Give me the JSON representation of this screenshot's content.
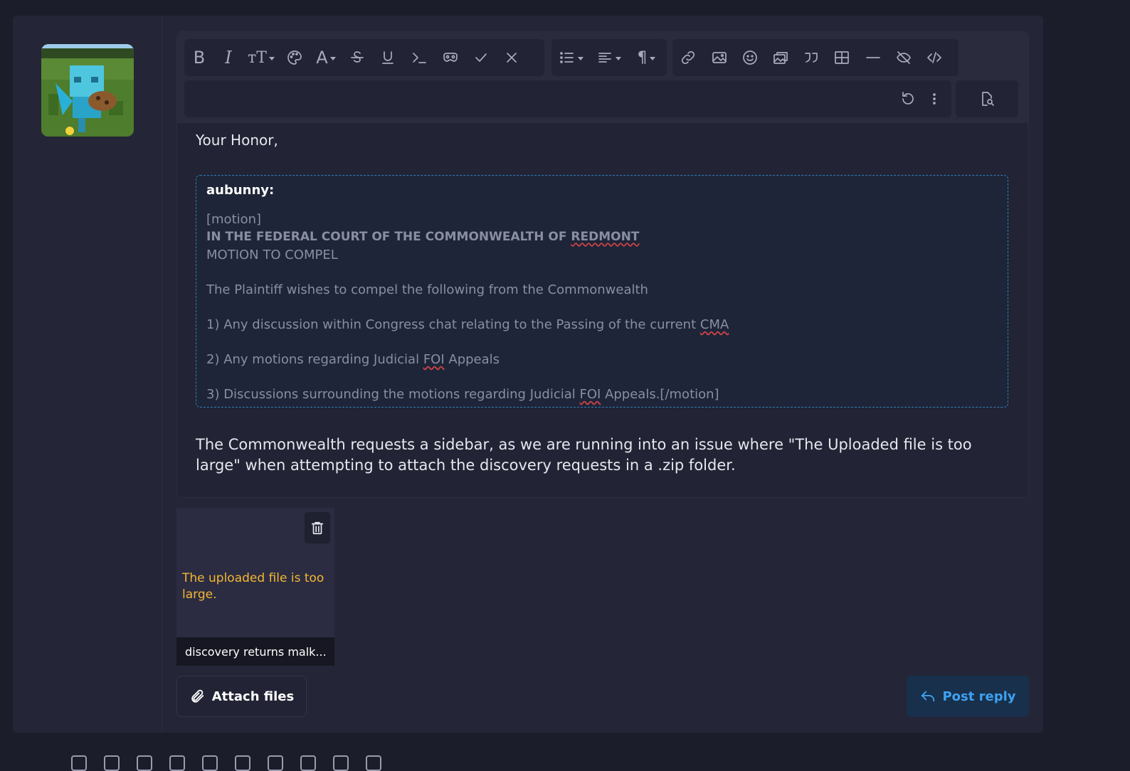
{
  "editor": {
    "greeting": "Your Honor,",
    "quote": {
      "author": "aubunny:",
      "lines": {
        "l1": "[motion]",
        "l2a": "IN THE FEDERAL COURT OF THE COMMONWEALTH OF ",
        "l2b": "REDMONT",
        "l3": "MOTION TO COMPEL",
        "l4": "The Plaintiff wishes to compel the following from the Commonwealth",
        "l5a": "1) Any discussion within Congress chat relating to the Passing of the current ",
        "l5b": "CMA",
        "l6a": "2) Any motions regarding Judicial ",
        "l6b": "FOI",
        "l6c": " Appeals",
        "l7a": "3) Discussions surrounding the motions regarding Judicial ",
        "l7b": "FOI",
        "l7c": " Appeals.[/motion]"
      }
    },
    "body": "The Commonwealth requests a sidebar, as we are running into an issue where \"The Uploaded file is too large\" when attempting to attach the discovery requests in a .zip folder."
  },
  "attachment": {
    "error": "The uploaded file is too large.",
    "filename": "discovery returns malk..."
  },
  "actions": {
    "attach_label": "Attach files",
    "post_label": "Post reply"
  },
  "colors": {
    "background": "#1c1d2b",
    "panel": "#242536",
    "accent": "#3ea1f2",
    "warning": "#f5b731"
  }
}
